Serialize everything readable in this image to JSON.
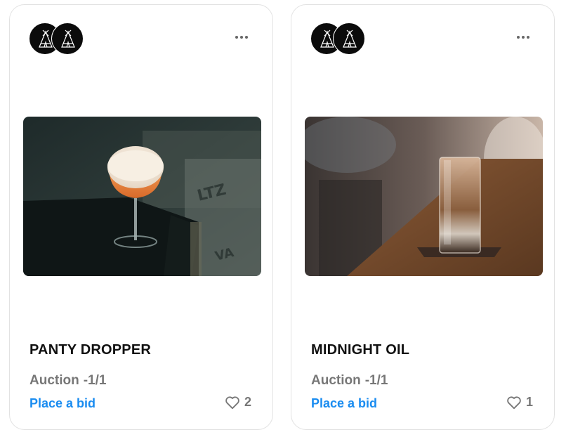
{
  "cards": [
    {
      "title": "PANTY DROPPER",
      "sale_type": "Auction",
      "edition": "-1/1",
      "action": "Place a bid",
      "likes": "2",
      "image_icon": "cocktail-coupe-image"
    },
    {
      "title": "MIDNIGHT OIL",
      "sale_type": "Auction",
      "edition": "-1/1",
      "action": "Place a bid",
      "likes": "1",
      "image_icon": "highball-glass-image"
    }
  ],
  "colors": {
    "link": "#1a8cf0",
    "muted": "#777777",
    "title": "#111111",
    "avatar_bg": "#0b0b0b"
  }
}
